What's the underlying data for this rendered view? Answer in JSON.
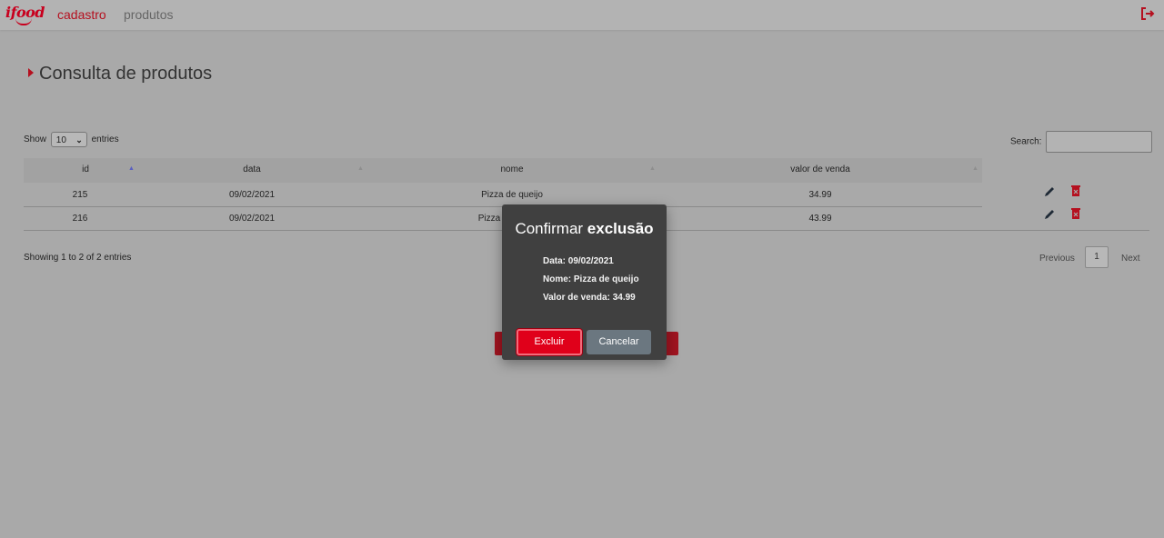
{
  "navbar": {
    "brand": "ifood",
    "links": [
      {
        "label": "cadastro",
        "active": true
      },
      {
        "label": "produtos",
        "active": false
      }
    ],
    "logout_icon": "logout-icon",
    "accent_color": "#b5101f"
  },
  "page": {
    "title": "Consulta de produtos"
  },
  "table_controls": {
    "show_label": "Show",
    "length_value": "10",
    "entries_label": "entries",
    "search_label": "Search:",
    "search_value": ""
  },
  "table": {
    "columns": [
      "id",
      "data",
      "nome",
      "valor de venda"
    ],
    "rows": [
      {
        "id": "215",
        "data": "09/02/2021",
        "nome": "Pizza de queijo",
        "valor": "34.99"
      },
      {
        "id": "216",
        "data": "09/02/2021",
        "nome": "Pizza",
        "valor": "43.99"
      }
    ],
    "row_actions": [
      "edit-icon",
      "trash-icon"
    ]
  },
  "footer": {
    "info": "Showing 1 to 2 of 2 entries",
    "previous": "Previous",
    "current_page": "1",
    "next": "Next"
  },
  "modal": {
    "title_regular": "Confirmar",
    "title_bold": "exclusão",
    "data_line": "Data: 09/02/2021",
    "nome_line": "Nome: Pizza de queijo",
    "valor_line": "Valor de venda: 34.99",
    "confirm_label": "Excluir",
    "cancel_label": "Cancelar",
    "confirm_color": "#e0001a",
    "cancel_color": "#6b7780"
  }
}
